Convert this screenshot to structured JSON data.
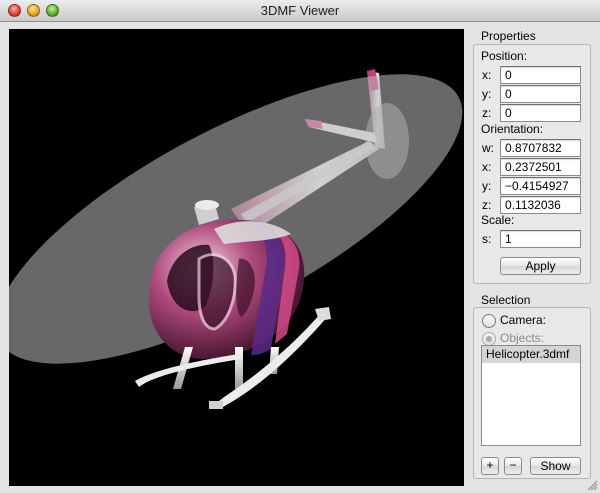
{
  "window": {
    "title": "3DMF Viewer"
  },
  "properties": {
    "heading": "Properties",
    "position": {
      "label": "Position:",
      "x_label": "x:",
      "x": "0",
      "y_label": "y:",
      "y": "0",
      "z_label": "z:",
      "z": "0"
    },
    "orientation": {
      "label": "Orientation:",
      "w_label": "w:",
      "w": "0.8707832",
      "x_label": "x:",
      "x": "0.2372501",
      "y_label": "y:",
      "y": "−0.4154927",
      "z_label": "z:",
      "z": "0.1132036"
    },
    "scale": {
      "label": "Scale:",
      "s_label": "s:",
      "s": "1"
    },
    "apply_label": "Apply"
  },
  "selection": {
    "heading": "Selection",
    "camera_label": "Camera:",
    "objects_label": "Objects:",
    "selected_mode": "objects",
    "objects": [
      "Helicopter.3dmf"
    ],
    "add_label": "+",
    "remove_label": "−",
    "show_label": "Show"
  },
  "colors": {
    "viewport_bg": "#000000",
    "model_accent": "#c0407a"
  }
}
